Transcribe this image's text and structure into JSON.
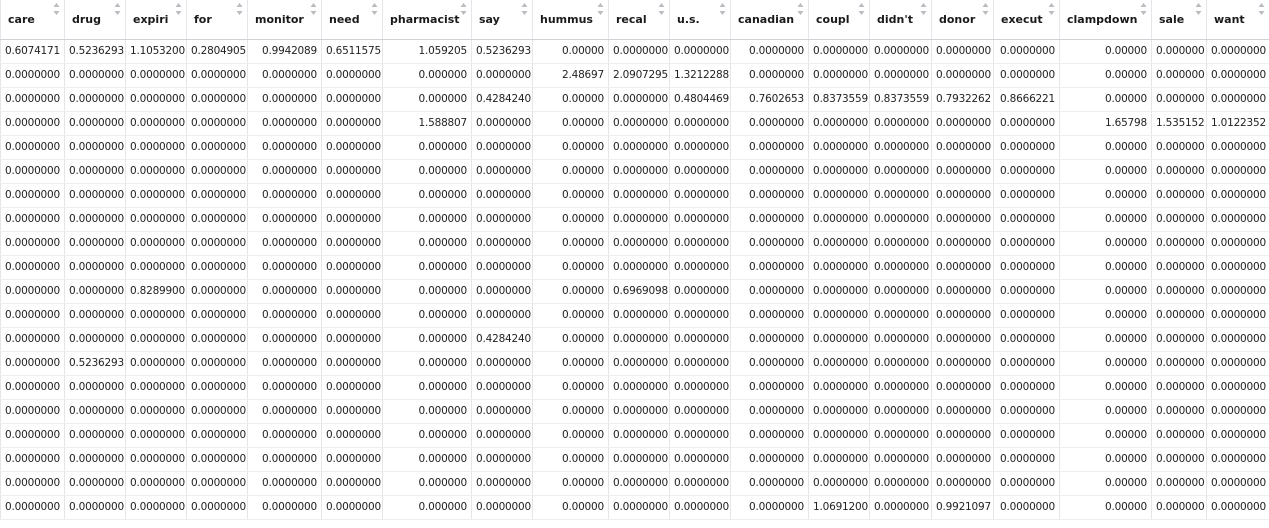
{
  "table": {
    "columns": [
      "care",
      "drug",
      "expiri",
      "for",
      "monitor",
      "need",
      "pharmacist",
      "say",
      "hummus",
      "recal",
      "u.s.",
      "canadian",
      "coupl",
      "didn't",
      "donor",
      "execut",
      "clampdown",
      "sale",
      "want"
    ],
    "rows": [
      [
        "0.6074171",
        "0.5236293",
        "1.1053200",
        "0.2804905",
        "0.9942089",
        "0.6511575",
        "1.059205",
        "0.5236293",
        "0.00000",
        "0.0000000",
        "0.0000000",
        "0.0000000",
        "0.0000000",
        "0.0000000",
        "0.0000000",
        "0.0000000",
        "0.00000",
        "0.000000",
        "0.0000000"
      ],
      [
        "0.0000000",
        "0.0000000",
        "0.0000000",
        "0.0000000",
        "0.0000000",
        "0.0000000",
        "0.000000",
        "0.0000000",
        "2.48697",
        "2.0907295",
        "1.3212288",
        "0.0000000",
        "0.0000000",
        "0.0000000",
        "0.0000000",
        "0.0000000",
        "0.00000",
        "0.000000",
        "0.0000000"
      ],
      [
        "0.0000000",
        "0.0000000",
        "0.0000000",
        "0.0000000",
        "0.0000000",
        "0.0000000",
        "0.000000",
        "0.4284240",
        "0.00000",
        "0.0000000",
        "0.4804469",
        "0.7602653",
        "0.8373559",
        "0.8373559",
        "0.7932262",
        "0.8666221",
        "0.00000",
        "0.000000",
        "0.0000000"
      ],
      [
        "0.0000000",
        "0.0000000",
        "0.0000000",
        "0.0000000",
        "0.0000000",
        "0.0000000",
        "1.588807",
        "0.0000000",
        "0.00000",
        "0.0000000",
        "0.0000000",
        "0.0000000",
        "0.0000000",
        "0.0000000",
        "0.0000000",
        "0.0000000",
        "1.65798",
        "1.535152",
        "1.0122352"
      ],
      [
        "0.0000000",
        "0.0000000",
        "0.0000000",
        "0.0000000",
        "0.0000000",
        "0.0000000",
        "0.000000",
        "0.0000000",
        "0.00000",
        "0.0000000",
        "0.0000000",
        "0.0000000",
        "0.0000000",
        "0.0000000",
        "0.0000000",
        "0.0000000",
        "0.00000",
        "0.000000",
        "0.0000000"
      ],
      [
        "0.0000000",
        "0.0000000",
        "0.0000000",
        "0.0000000",
        "0.0000000",
        "0.0000000",
        "0.000000",
        "0.0000000",
        "0.00000",
        "0.0000000",
        "0.0000000",
        "0.0000000",
        "0.0000000",
        "0.0000000",
        "0.0000000",
        "0.0000000",
        "0.00000",
        "0.000000",
        "0.0000000"
      ],
      [
        "0.0000000",
        "0.0000000",
        "0.0000000",
        "0.0000000",
        "0.0000000",
        "0.0000000",
        "0.000000",
        "0.0000000",
        "0.00000",
        "0.0000000",
        "0.0000000",
        "0.0000000",
        "0.0000000",
        "0.0000000",
        "0.0000000",
        "0.0000000",
        "0.00000",
        "0.000000",
        "0.0000000"
      ],
      [
        "0.0000000",
        "0.0000000",
        "0.0000000",
        "0.0000000",
        "0.0000000",
        "0.0000000",
        "0.000000",
        "0.0000000",
        "0.00000",
        "0.0000000",
        "0.0000000",
        "0.0000000",
        "0.0000000",
        "0.0000000",
        "0.0000000",
        "0.0000000",
        "0.00000",
        "0.000000",
        "0.0000000"
      ],
      [
        "0.0000000",
        "0.0000000",
        "0.0000000",
        "0.0000000",
        "0.0000000",
        "0.0000000",
        "0.000000",
        "0.0000000",
        "0.00000",
        "0.0000000",
        "0.0000000",
        "0.0000000",
        "0.0000000",
        "0.0000000",
        "0.0000000",
        "0.0000000",
        "0.00000",
        "0.000000",
        "0.0000000"
      ],
      [
        "0.0000000",
        "0.0000000",
        "0.0000000",
        "0.0000000",
        "0.0000000",
        "0.0000000",
        "0.000000",
        "0.0000000",
        "0.00000",
        "0.0000000",
        "0.0000000",
        "0.0000000",
        "0.0000000",
        "0.0000000",
        "0.0000000",
        "0.0000000",
        "0.00000",
        "0.000000",
        "0.0000000"
      ],
      [
        "0.0000000",
        "0.0000000",
        "0.8289900",
        "0.0000000",
        "0.0000000",
        "0.0000000",
        "0.000000",
        "0.0000000",
        "0.00000",
        "0.6969098",
        "0.0000000",
        "0.0000000",
        "0.0000000",
        "0.0000000",
        "0.0000000",
        "0.0000000",
        "0.00000",
        "0.000000",
        "0.0000000"
      ],
      [
        "0.0000000",
        "0.0000000",
        "0.0000000",
        "0.0000000",
        "0.0000000",
        "0.0000000",
        "0.000000",
        "0.0000000",
        "0.00000",
        "0.0000000",
        "0.0000000",
        "0.0000000",
        "0.0000000",
        "0.0000000",
        "0.0000000",
        "0.0000000",
        "0.00000",
        "0.000000",
        "0.0000000"
      ],
      [
        "0.0000000",
        "0.0000000",
        "0.0000000",
        "0.0000000",
        "0.0000000",
        "0.0000000",
        "0.000000",
        "0.4284240",
        "0.00000",
        "0.0000000",
        "0.0000000",
        "0.0000000",
        "0.0000000",
        "0.0000000",
        "0.0000000",
        "0.0000000",
        "0.00000",
        "0.000000",
        "0.0000000"
      ],
      [
        "0.0000000",
        "0.5236293",
        "0.0000000",
        "0.0000000",
        "0.0000000",
        "0.0000000",
        "0.000000",
        "0.0000000",
        "0.00000",
        "0.0000000",
        "0.0000000",
        "0.0000000",
        "0.0000000",
        "0.0000000",
        "0.0000000",
        "0.0000000",
        "0.00000",
        "0.000000",
        "0.0000000"
      ],
      [
        "0.0000000",
        "0.0000000",
        "0.0000000",
        "0.0000000",
        "0.0000000",
        "0.0000000",
        "0.000000",
        "0.0000000",
        "0.00000",
        "0.0000000",
        "0.0000000",
        "0.0000000",
        "0.0000000",
        "0.0000000",
        "0.0000000",
        "0.0000000",
        "0.00000",
        "0.000000",
        "0.0000000"
      ],
      [
        "0.0000000",
        "0.0000000",
        "0.0000000",
        "0.0000000",
        "0.0000000",
        "0.0000000",
        "0.000000",
        "0.0000000",
        "0.00000",
        "0.0000000",
        "0.0000000",
        "0.0000000",
        "0.0000000",
        "0.0000000",
        "0.0000000",
        "0.0000000",
        "0.00000",
        "0.000000",
        "0.0000000"
      ],
      [
        "0.0000000",
        "0.0000000",
        "0.0000000",
        "0.0000000",
        "0.0000000",
        "0.0000000",
        "0.000000",
        "0.0000000",
        "0.00000",
        "0.0000000",
        "0.0000000",
        "0.0000000",
        "0.0000000",
        "0.0000000",
        "0.0000000",
        "0.0000000",
        "0.00000",
        "0.000000",
        "0.0000000"
      ],
      [
        "0.0000000",
        "0.0000000",
        "0.0000000",
        "0.0000000",
        "0.0000000",
        "0.0000000",
        "0.000000",
        "0.0000000",
        "0.00000",
        "0.0000000",
        "0.0000000",
        "0.0000000",
        "0.0000000",
        "0.0000000",
        "0.0000000",
        "0.0000000",
        "0.00000",
        "0.000000",
        "0.0000000"
      ],
      [
        "0.0000000",
        "0.0000000",
        "0.0000000",
        "0.0000000",
        "0.0000000",
        "0.0000000",
        "0.000000",
        "0.0000000",
        "0.00000",
        "0.0000000",
        "0.0000000",
        "0.0000000",
        "0.0000000",
        "0.0000000",
        "0.0000000",
        "0.0000000",
        "0.00000",
        "0.000000",
        "0.0000000"
      ],
      [
        "0.0000000",
        "0.0000000",
        "0.0000000",
        "0.0000000",
        "0.0000000",
        "0.0000000",
        "0.000000",
        "0.0000000",
        "0.00000",
        "0.0000000",
        "0.0000000",
        "0.0000000",
        "1.0691200",
        "0.0000000",
        "0.9921097",
        "0.0000000",
        "0.00000",
        "0.000000",
        "0.0000000"
      ]
    ]
  },
  "icons": {
    "sort": "sort-arrows-icon"
  },
  "colors": {
    "header_border": "#cfd3d7",
    "grid": "#e3e6ea",
    "sort_icon": "#b8bcc1"
  }
}
